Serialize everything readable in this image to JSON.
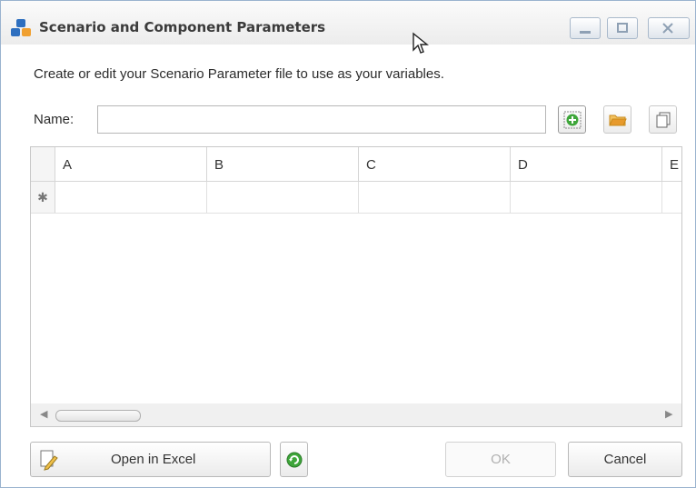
{
  "window": {
    "title": "Scenario and Component Parameters",
    "icon": "blocks-app-icon",
    "controls": [
      "minimize-icon",
      "maximize-icon",
      "close-icon"
    ]
  },
  "description": "Create or edit your Scenario Parameter file to use as your variables.",
  "name_field": {
    "label": "Name:",
    "value": "",
    "placeholder": ""
  },
  "toolbar": {
    "icons": [
      "add-parameter-icon",
      "open-folder-icon",
      "copy-icon"
    ]
  },
  "grid": {
    "columns": [
      "A",
      "B",
      "C",
      "D",
      "E"
    ],
    "new_row_marker": "✱",
    "rows": [
      [
        "",
        "",
        "",
        "",
        ""
      ]
    ]
  },
  "buttons": {
    "open_excel": "Open in Excel",
    "ok": "OK",
    "cancel": "Cancel",
    "ok_enabled": false
  },
  "colors": {
    "accent_blue": "#2e6fbf",
    "add_green": "#3ea63a",
    "folder_orange": "#e79a2c"
  }
}
